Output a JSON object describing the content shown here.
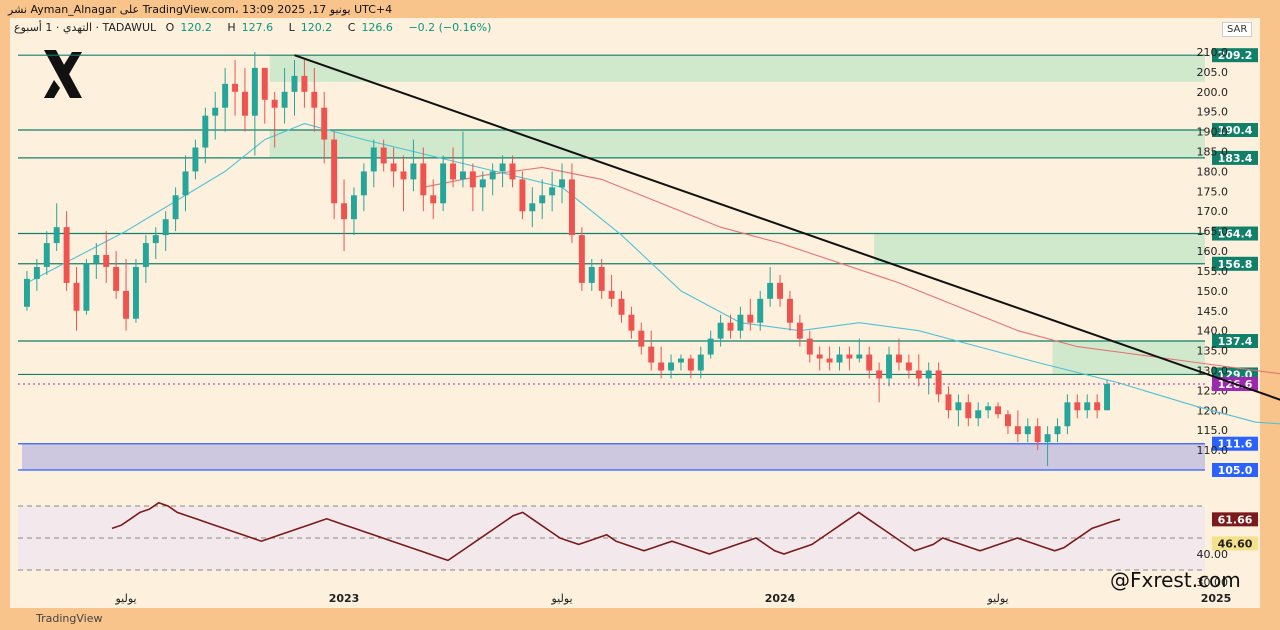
{
  "header": {
    "title_text": "نشر Ayman_Alnagar على TradingView.com، يونيو 17, 2025 13:09 UTC+4",
    "symbol_text": "التهدي · 1 أسبوع · TADAWUL",
    "open_label": "O",
    "open": "120.2",
    "high_label": "H",
    "high": "127.6",
    "low_label": "L",
    "low": "120.2",
    "close_label": "C",
    "close": "126.6",
    "change": "−0.2 (−0.16%)",
    "currency": "SAR"
  },
  "footer": {
    "tv_logo_text": "TradingView"
  },
  "watermark": "@Fxrest.com",
  "colors": {
    "up": "#26a69a",
    "down": "#ef5350",
    "zone_green": "#c8e6c9",
    "zone_purple": "#c6bfe0",
    "level_line": "#11806a",
    "support_line": "#2962ff",
    "ema_fast": "#4fc3d7",
    "ema_slow": "#e57373",
    "trendline": "#111111",
    "rsi_line": "#7a1a1a",
    "current_price": "#9c27b0"
  },
  "chart_data": [
    {
      "type": "candlestick",
      "title": "",
      "ylim": [
        105.0,
        210.5
      ],
      "y_ticks": [
        110.0,
        115.0,
        120.0,
        125.0,
        130.0,
        135.0,
        140.0,
        145.0,
        150.0,
        155.0,
        160.0,
        165.0,
        170.0,
        175.0,
        180.0,
        185.0,
        190.0,
        195.0,
        200.0,
        205.0,
        210.0
      ],
      "x_ticks": [
        {
          "label": "يوليو",
          "index": 10
        },
        {
          "label": "2023",
          "index": 32
        },
        {
          "label": "يوليو",
          "index": 54
        },
        {
          "label": "2024",
          "index": 76
        },
        {
          "label": "يوليو",
          "index": 98
        },
        {
          "label": "2025",
          "index": 120
        },
        {
          "label": "يوليو",
          "index": 142
        }
      ],
      "levels": [
        209.2,
        190.4,
        183.4,
        164.4,
        156.8,
        137.4,
        129.0
      ],
      "level_labels": [
        "209.2",
        "190.4",
        "183.4",
        "164.4",
        "156.8",
        "137.4",
        "129.0"
      ],
      "support_levels": [
        111.6,
        105.0
      ],
      "support_labels": [
        "111.6",
        "105.0"
      ],
      "current_price": 126.6,
      "current_price_label": "126.6",
      "zones": [
        {
          "from_index": 25,
          "to_index": 150,
          "low": 202.5,
          "high": 209.2,
          "color": "zone_green"
        },
        {
          "from_index": 25,
          "to_index": 150,
          "low": 183.4,
          "high": 190.4,
          "color": "zone_green"
        },
        {
          "from_index": 86,
          "to_index": 150,
          "low": 156.8,
          "high": 164.4,
          "color": "zone_green"
        },
        {
          "from_index": 104,
          "to_index": 150,
          "low": 129.0,
          "high": 137.4,
          "color": "zone_green"
        },
        {
          "from_index": 0,
          "to_index": 150,
          "low": 105.0,
          "high": 111.6,
          "color": "zone_purple"
        }
      ],
      "trendline": {
        "start_index": 27,
        "start_value": 209.2,
        "end_index": 137,
        "end_value": 113.5
      },
      "ohlc": [
        [
          146,
          155,
          145,
          153
        ],
        [
          153,
          158,
          150,
          156
        ],
        [
          156,
          165,
          154,
          162
        ],
        [
          162,
          172,
          160,
          166
        ],
        [
          166,
          170,
          150,
          152
        ],
        [
          152,
          156,
          140,
          145
        ],
        [
          145,
          158,
          144,
          157
        ],
        [
          157,
          162,
          153,
          159
        ],
        [
          159,
          165,
          152,
          156
        ],
        [
          156,
          160,
          148,
          150
        ],
        [
          150,
          158,
          140,
          143
        ],
        [
          143,
          158,
          142,
          156
        ],
        [
          156,
          164,
          152,
          162
        ],
        [
          162,
          166,
          158,
          164
        ],
        [
          164,
          170,
          160,
          168
        ],
        [
          168,
          176,
          165,
          174
        ],
        [
          174,
          184,
          170,
          180
        ],
        [
          180,
          188,
          178,
          186
        ],
        [
          186,
          196,
          182,
          194
        ],
        [
          194,
          200,
          188,
          196
        ],
        [
          196,
          206,
          190,
          202
        ],
        [
          202,
          208,
          194,
          200
        ],
        [
          200,
          206,
          190,
          194
        ],
        [
          194,
          210,
          184,
          206
        ],
        [
          206,
          206,
          192,
          198
        ],
        [
          198,
          200,
          186,
          196
        ],
        [
          196,
          206,
          192,
          200
        ],
        [
          200,
          208,
          194,
          204
        ],
        [
          204,
          208,
          196,
          200
        ],
        [
          200,
          206,
          190,
          196
        ],
        [
          196,
          200,
          182,
          188
        ],
        [
          188,
          190,
          168,
          172
        ],
        [
          172,
          178,
          160,
          168
        ],
        [
          168,
          176,
          164,
          174
        ],
        [
          174,
          182,
          170,
          180
        ],
        [
          180,
          188,
          176,
          186
        ],
        [
          186,
          188,
          180,
          182
        ],
        [
          182,
          186,
          176,
          180
        ],
        [
          180,
          184,
          170,
          178
        ],
        [
          178,
          188,
          175,
          182
        ],
        [
          182,
          186,
          170,
          174
        ],
        [
          174,
          178,
          168,
          172
        ],
        [
          172,
          184,
          170,
          182
        ],
        [
          182,
          186,
          176,
          178
        ],
        [
          178,
          190,
          176,
          180
        ],
        [
          180,
          182,
          170,
          176
        ],
        [
          176,
          180,
          170,
          178
        ],
        [
          178,
          182,
          174,
          180
        ],
        [
          180,
          184,
          176,
          182
        ],
        [
          182,
          184,
          176,
          178
        ],
        [
          178,
          180,
          168,
          170
        ],
        [
          170,
          176,
          166,
          172
        ],
        [
          172,
          178,
          168,
          174
        ],
        [
          174,
          180,
          170,
          176
        ],
        [
          176,
          182,
          172,
          178
        ],
        [
          178,
          182,
          162,
          164
        ],
        [
          164,
          166,
          150,
          152
        ],
        [
          152,
          158,
          150,
          156
        ],
        [
          156,
          158,
          148,
          150
        ],
        [
          150,
          154,
          146,
          148
        ],
        [
          148,
          150,
          142,
          144
        ],
        [
          144,
          146,
          138,
          140
        ],
        [
          140,
          142,
          134,
          136
        ],
        [
          136,
          140,
          130,
          132
        ],
        [
          132,
          136,
          128,
          130
        ],
        [
          130,
          134,
          128,
          132
        ],
        [
          132,
          134,
          130,
          133
        ],
        [
          133,
          134,
          128,
          130
        ],
        [
          130,
          136,
          128,
          134
        ],
        [
          134,
          140,
          133,
          138
        ],
        [
          138,
          144,
          136,
          142
        ],
        [
          142,
          144,
          138,
          140
        ],
        [
          140,
          146,
          138,
          144
        ],
        [
          144,
          148,
          140,
          142
        ],
        [
          142,
          150,
          140,
          148
        ],
        [
          148,
          156,
          146,
          152
        ],
        [
          152,
          154,
          146,
          148
        ],
        [
          148,
          150,
          140,
          142
        ],
        [
          142,
          144,
          136,
          138
        ],
        [
          138,
          140,
          132,
          134
        ],
        [
          134,
          136,
          130,
          133
        ],
        [
          133,
          136,
          130,
          132
        ],
        [
          132,
          136,
          130,
          134
        ],
        [
          134,
          136,
          130,
          133
        ],
        [
          133,
          138,
          132,
          134
        ],
        [
          134,
          136,
          128,
          130
        ],
        [
          130,
          132,
          122,
          128
        ],
        [
          128,
          136,
          126,
          134
        ],
        [
          134,
          138,
          130,
          132
        ],
        [
          132,
          134,
          128,
          130
        ],
        [
          130,
          134,
          126,
          128
        ],
        [
          128,
          132,
          124,
          130
        ],
        [
          130,
          132,
          122,
          124
        ],
        [
          124,
          126,
          118,
          120
        ],
        [
          120,
          124,
          116,
          122
        ],
        [
          122,
          124,
          116,
          118
        ],
        [
          118,
          122,
          116,
          120
        ],
        [
          120,
          122,
          118,
          121
        ],
        [
          121,
          122,
          118,
          119
        ],
        [
          119,
          120,
          114,
          116
        ],
        [
          116,
          120,
          112,
          114
        ],
        [
          114,
          118,
          112,
          116
        ],
        [
          116,
          118,
          110,
          112
        ],
        [
          112,
          116,
          106,
          114
        ],
        [
          114,
          118,
          112,
          116
        ],
        [
          116,
          124,
          114,
          122
        ],
        [
          122,
          124,
          118,
          120
        ],
        [
          120,
          124,
          118,
          122
        ],
        [
          122,
          124,
          118,
          120
        ],
        [
          120,
          127.6,
          120.2,
          126.6
        ]
      ],
      "ema_fast": [
        [
          0,
          152
        ],
        [
          10,
          165
        ],
        [
          20,
          180
        ],
        [
          24,
          188
        ],
        [
          28,
          192
        ],
        [
          34,
          188
        ],
        [
          44,
          182
        ],
        [
          54,
          176
        ],
        [
          60,
          164
        ],
        [
          66,
          150
        ],
        [
          72,
          142
        ],
        [
          78,
          140
        ],
        [
          84,
          142
        ],
        [
          90,
          140
        ],
        [
          96,
          136
        ],
        [
          102,
          132
        ],
        [
          110,
          127
        ],
        [
          118,
          121
        ],
        [
          124,
          117
        ],
        [
          130,
          116
        ],
        [
          136,
          116
        ],
        [
          140,
          118
        ]
      ],
      "ema_slow": [
        [
          40,
          176
        ],
        [
          46,
          179
        ],
        [
          52,
          181
        ],
        [
          58,
          178
        ],
        [
          64,
          172
        ],
        [
          70,
          166
        ],
        [
          76,
          162
        ],
        [
          82,
          157
        ],
        [
          88,
          152
        ],
        [
          94,
          146
        ],
        [
          100,
          140
        ],
        [
          106,
          136
        ],
        [
          112,
          134
        ],
        [
          118,
          132
        ],
        [
          124,
          130
        ],
        [
          130,
          128
        ],
        [
          134,
          124
        ],
        [
          140,
          123
        ]
      ]
    },
    {
      "type": "line",
      "title": "",
      "ylim": [
        30,
        75
      ],
      "levels": [
        70,
        50,
        30
      ],
      "value_labels": [
        "61.66",
        "46.60",
        "40.00",
        "30.00"
      ],
      "series": [
        {
          "values": [
            56,
            58,
            62,
            66,
            68,
            72,
            70,
            66,
            64,
            62,
            60,
            58,
            56,
            54,
            52,
            50,
            48,
            50,
            52,
            54,
            56,
            58,
            60,
            62,
            60,
            58,
            56,
            54,
            52,
            50,
            48,
            46,
            44,
            42,
            40,
            38,
            36,
            40,
            44,
            48,
            52,
            56,
            60,
            64,
            66,
            62,
            58,
            54,
            50,
            48,
            46,
            48,
            50,
            52,
            48,
            46,
            44,
            42,
            44,
            46,
            48,
            46,
            44,
            42,
            40,
            42,
            44,
            46,
            48,
            50,
            46,
            42,
            40,
            42,
            44,
            46,
            50,
            54,
            58,
            62,
            66,
            62,
            58,
            54,
            50,
            46,
            42,
            44,
            46,
            50,
            48,
            46,
            44,
            42,
            44,
            46,
            48,
            50,
            48,
            46,
            44,
            42,
            44,
            48,
            52,
            56,
            58,
            60,
            61.66
          ]
        }
      ]
    }
  ]
}
